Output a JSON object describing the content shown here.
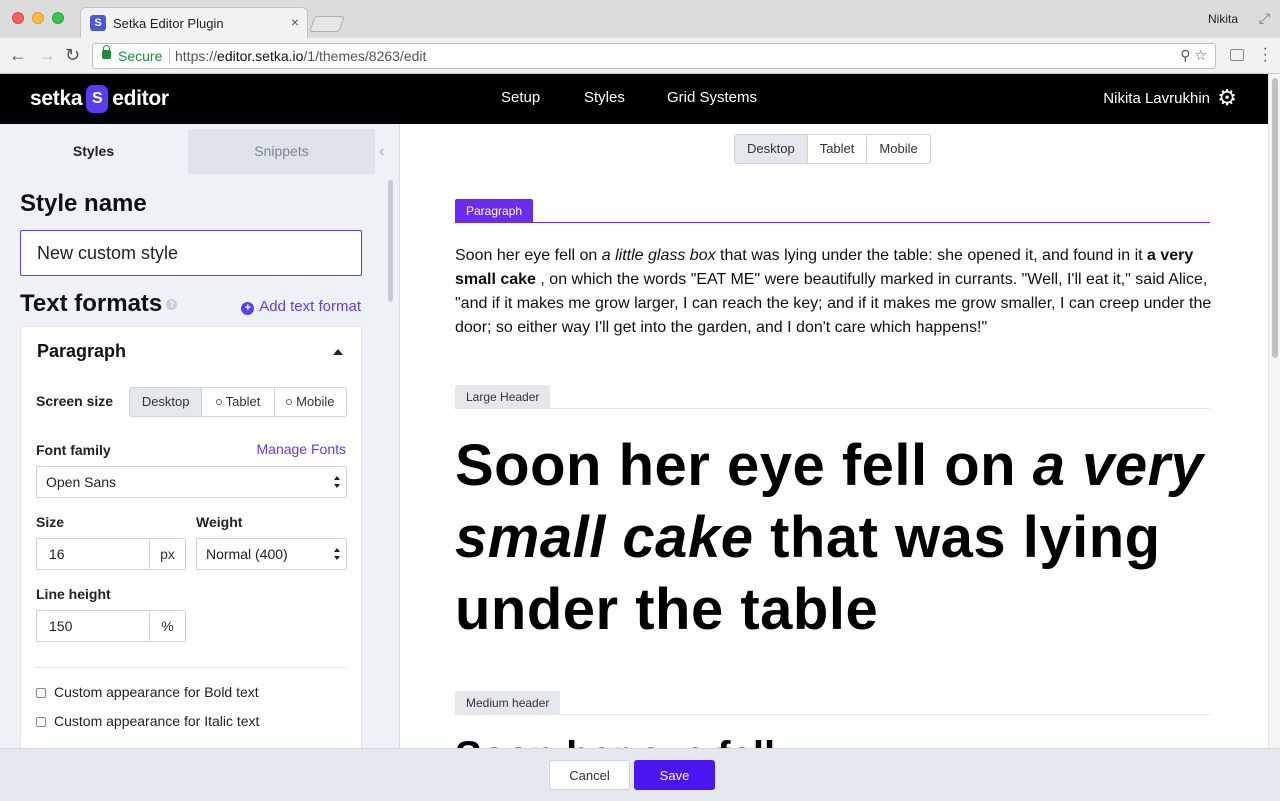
{
  "browser": {
    "tab_title": "Setka Editor Plugin",
    "tab_close": "×",
    "profile": "Nikita",
    "secure_label": "Secure",
    "url_scheme": "https://",
    "url_domain": "editor.setka.io",
    "url_path": "/1/themes/8263/edit"
  },
  "header": {
    "logo_left": "setka",
    "logo_mark": "S",
    "logo_right": "editor",
    "nav": [
      "Setup",
      "Styles",
      "Grid Systems"
    ],
    "user": "Nikita Lavrukhin"
  },
  "sidebar": {
    "tabs": [
      "Styles",
      "Snippets"
    ],
    "style_name_label": "Style name",
    "style_name_value": "New custom style",
    "text_formats_label": "Text formats",
    "help": "?",
    "add_text_format": "Add text format",
    "panel": {
      "title": "Paragraph",
      "screen_size_label": "Screen size",
      "screen_sizes": [
        "Desktop",
        "Tablet",
        "Mobile"
      ],
      "font_family_label": "Font family",
      "manage_fonts": "Manage Fonts",
      "font_family_value": "Open Sans",
      "size_label": "Size",
      "size_value": "16",
      "size_unit": "px",
      "weight_label": "Weight",
      "weight_value": "Normal (400)",
      "line_height_label": "Line height",
      "line_height_value": "150",
      "line_height_unit": "%",
      "checkbox_bold": "Custom appearance for Bold text",
      "checkbox_italic": "Custom appearance for Italic text"
    }
  },
  "preview": {
    "devices": [
      "Desktop",
      "Tablet",
      "Mobile"
    ],
    "paragraph_tag": "Paragraph",
    "paragraph": {
      "t1": "Soon her eye fell on ",
      "em": "a little glass box",
      "t2": " that was lying under the table: she opened it, and found in it ",
      "strong": "a very small cake",
      "t3": " , on which the words \"EAT ME\" were beautifully marked in currants. \"Well, I'll eat it,\" said Alice, \"and if it makes me grow larger, I can reach the key; and if it makes me grow smaller, I can creep under the door; so either way I'll get into the garden, and I don't care which happens!\""
    },
    "large_header_tag": "Large Header",
    "large_header": {
      "t1": "Soon her eye fell on ",
      "em": "a very small cake",
      "t2": " that was lying under the table"
    },
    "medium_header_tag": "Medium header",
    "medium_header_peek": "Soon her eye fell"
  },
  "footer": {
    "cancel": "Cancel",
    "save": "Save"
  },
  "colors": {
    "accent": "#5f3cf1",
    "save_button": "#4a16f0",
    "header_bg": "#000000"
  }
}
